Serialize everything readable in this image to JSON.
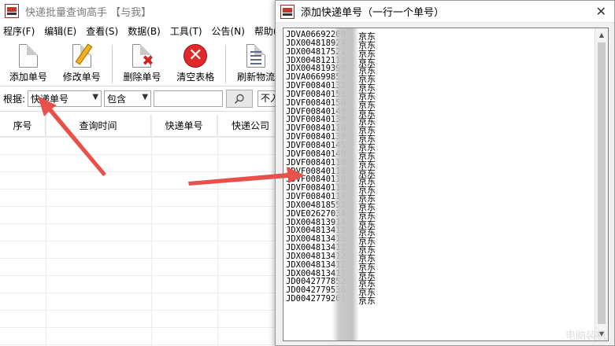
{
  "main_window": {
    "title": "快递批量查询高手 【与我】",
    "menu": [
      "程序(F)",
      "编辑(E)",
      "查看(S)",
      "数据(B)",
      "工具(T)",
      "公告(N)",
      "帮助(H)"
    ],
    "toolbar": {
      "add_label": "添加单号",
      "edit_label": "修改单号",
      "delete_label": "删除单号",
      "clear_label": "清空表格",
      "refresh_label": "刷新物流"
    },
    "filter": {
      "label": "根据:",
      "field_value": "快递单号",
      "match_value": "包含",
      "search_value": "",
      "extra_value": "不入"
    },
    "grid": {
      "columns": [
        "序号",
        "查询时间",
        "快递单号",
        "快递公司"
      ]
    }
  },
  "dialog": {
    "title": "添加快递单号（一行一个单号）",
    "close_glyph": "✕",
    "lines": [
      {
        "num": "JDVA06692209",
        "company": "京东"
      },
      {
        "num": "JDX004818924",
        "company": "京东"
      },
      {
        "num": "JDX004817521",
        "company": "京东"
      },
      {
        "num": "JDX004812119",
        "company": "京东"
      },
      {
        "num": "JDX004819399",
        "company": "京东"
      },
      {
        "num": "JDVA06699858",
        "company": "京东"
      },
      {
        "num": "JDVF00840132",
        "company": "京东"
      },
      {
        "num": "JDVF00840153",
        "company": "京东"
      },
      {
        "num": "JDVF00840156",
        "company": "京东"
      },
      {
        "num": "JDVF00840149",
        "company": "京东"
      },
      {
        "num": "JDVF00840130",
        "company": "京东"
      },
      {
        "num": "JDVF00840118",
        "company": "京东"
      },
      {
        "num": "JDVF00840139",
        "company": "京东"
      },
      {
        "num": "JDVF00840145",
        "company": "京东"
      },
      {
        "num": "JDVF00840140",
        "company": "京东"
      },
      {
        "num": "JDVF00840118",
        "company": "京东"
      },
      {
        "num": "JDVF00840118",
        "company": "京东"
      },
      {
        "num": "JDVF00840118",
        "company": "京东"
      },
      {
        "num": "JDVF00840118",
        "company": "京东"
      },
      {
        "num": "JDVF00840118",
        "company": "京东"
      },
      {
        "num": "JDX004818552",
        "company": "京东"
      },
      {
        "num": "JDVE02627034",
        "company": "京东"
      },
      {
        "num": "JDX004813914",
        "company": "京东"
      },
      {
        "num": "JDX004813413",
        "company": "京东"
      },
      {
        "num": "JDX004813415",
        "company": "京东"
      },
      {
        "num": "JDX004813413",
        "company": "京东"
      },
      {
        "num": "JDX004813412",
        "company": "京东"
      },
      {
        "num": "JDX004813412",
        "company": "京东"
      },
      {
        "num": "JDX004813411",
        "company": "京东"
      },
      {
        "num": "JD0042777852",
        "company": "京东"
      },
      {
        "num": "JD0042779536",
        "company": "京东"
      },
      {
        "num": "JD0042779201",
        "company": "京东"
      }
    ],
    "watermark": "电脑装机"
  },
  "colors": {
    "arrow": "#e8504a",
    "clear_button": "#e02a2a"
  },
  "icons": {
    "app": "app-logo-icon",
    "add": "new-document-icon",
    "edit": "pencil-edit-icon",
    "delete": "document-delete-icon",
    "clear": "clear-x-circle-icon",
    "refresh": "refresh-list-icon",
    "search": "search-icon"
  }
}
